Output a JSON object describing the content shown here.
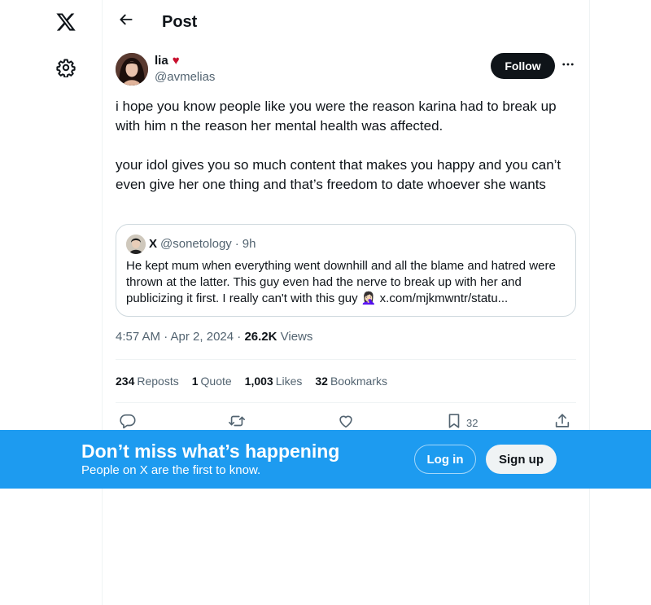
{
  "nav": {
    "logo_icon": "x-logo-icon",
    "settings_icon": "gear-icon"
  },
  "header": {
    "title": "Post",
    "back_icon": "arrow-left-icon"
  },
  "tweet": {
    "author": {
      "display_name": "lia",
      "name_emoji": "♥",
      "handle": "@avmelias"
    },
    "follow_label": "Follow",
    "more_icon": "more-horizontal-icon",
    "paragraphs": [
      "i hope you know people like you were the reason karina had to break up with him n the reason her mental health was affected.",
      "your idol gives you so much content that makes you happy and you can’t even give her one thing and that’s freedom to date whoever she wants"
    ],
    "quote": {
      "display_name": "X",
      "handle": "@sonetology",
      "separator": "·",
      "time": "9h",
      "text": "He kept mum when everything went downhill and all the blame and hatred were thrown at the latter. This guy even had the nerve to break up with her and publicizing it first. I really can't with this guy 🤦🏻‍♀️ x.com/mjkmwntr/statu..."
    },
    "timestamp": "4:57 AM · Apr 2, 2024",
    "meta_sep": "·",
    "views_count": "26.2K",
    "views_label": "Views",
    "stats": {
      "reposts_count": "234",
      "reposts_label": "Reposts",
      "quotes_count": "1",
      "quotes_label": "Quote",
      "likes_count": "1,003",
      "likes_label": "Likes",
      "bookmarks_count": "32",
      "bookmarks_label": "Bookmarks"
    },
    "actions": {
      "reply_icon": "reply-icon",
      "repost_icon": "repost-icon",
      "like_icon": "heart-icon",
      "bookmark_icon": "bookmark-icon",
      "bookmark_count": "32",
      "share_icon": "share-icon"
    }
  },
  "banner": {
    "title": "Don’t miss what’s happening",
    "subtitle": "People on X are the first to know.",
    "login_label": "Log in",
    "signup_label": "Sign up",
    "color": "#1d9bf0"
  }
}
